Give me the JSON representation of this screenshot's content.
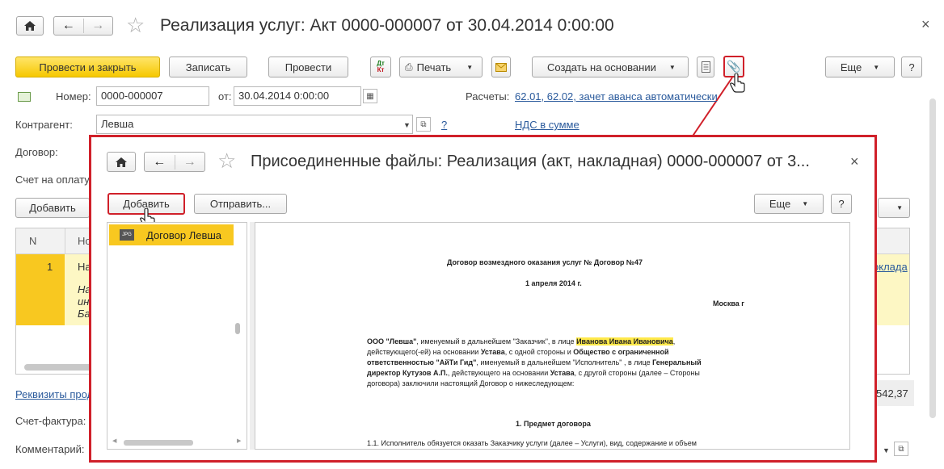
{
  "window": {
    "title": "Реализация услуг: Акт 0000-000007 от 30.04.2014 0:00:00",
    "close_glyph": "×"
  },
  "toolbar": {
    "post_close": "Провести и закрыть",
    "save": "Записать",
    "post": "Провести",
    "print": "Печать",
    "create_based": "Создать на основании",
    "more": "Еще",
    "help": "?"
  },
  "form": {
    "number_label": "Номер:",
    "number_value": "0000-000007",
    "date_label": "от:",
    "date_value": "30.04.2014  0:00:00",
    "settlements_label": "Расчеты:",
    "settlements_link": "62.01, 62.02, зачет аванса автоматически",
    "contractor_label": "Контрагент:",
    "contractor_value": "Левша",
    "contractor_help": "?",
    "vat_link": "НДС в сумме",
    "contract_label": "Договор:",
    "invoice_label": "Счет на оплату",
    "add_button": "Добавить",
    "table_col_n": "N",
    "table_col_name": "Но",
    "row1_n": "1",
    "row1_name": "На",
    "row1_sub1": "На",
    "row1_sub2": "ин",
    "row1_sub3": "Ба",
    "row1_right_link": "оклада",
    "requisites_link": "Реквизиты прод",
    "total_value": "542,37",
    "invoice_factura_label": "Счет-фактура:",
    "comment_label": "Комментарий:"
  },
  "dialog": {
    "title": "Присоединенные файлы: Реализация (акт, накладная) 0000-000007 от 3...",
    "add": "Добавить",
    "send": "Отправить...",
    "more": "Еще",
    "help": "?",
    "close_glyph": "×",
    "files": [
      {
        "name": "Договор Левша",
        "icon": "jpg-file-icon",
        "badge": "JPG"
      }
    ]
  },
  "document": {
    "title": "Договор возмездного оказания услуг № Договор №47",
    "date": "1 апреля 2014 г.",
    "city": "Москва г",
    "p1": [
      {
        "t": "ООО \"Левша\"",
        "s": "b"
      },
      {
        "t": ", именуемый в дальнейшем \"Заказчик\", в лице ",
        "s": ""
      },
      {
        "t": "Иванова Ивана Ивановича",
        "s": "hl"
      },
      {
        "t": ",",
        "s": ""
      }
    ],
    "p2": [
      {
        "t": "действующего(-ей) на основании ",
        "s": ""
      },
      {
        "t": "Устава",
        "s": "b"
      },
      {
        "t": ", с одной стороны и ",
        "s": ""
      },
      {
        "t": "Общество с ограниченной",
        "s": "b"
      }
    ],
    "p3": [
      {
        "t": "ответственностью \"АйТи Гид\"",
        "s": "b"
      },
      {
        "t": ", именуемый в дальнейшем \"Исполнитель\" , в лице ",
        "s": ""
      },
      {
        "t": "Генеральный",
        "s": "b"
      }
    ],
    "p4": [
      {
        "t": "директор Кутузов А.П.",
        "s": "b"
      },
      {
        "t": ", действующего на основании ",
        "s": ""
      },
      {
        "t": "Устава",
        "s": "b"
      },
      {
        "t": ", с другой стороны (далее – Стороны",
        "s": ""
      }
    ],
    "p5": [
      {
        "t": "договора) заключили настоящий Договор о нижеследующем:",
        "s": ""
      }
    ],
    "section1": "1. Предмет договора",
    "clause11": "1.1. Исполнитель обязуется оказать Заказчику услуги (далее – Услуги), вид, содержание и объем"
  },
  "colors": {
    "accent_yellow": "#f6c800",
    "highlight": "#ffe94a",
    "callout_red": "#d0202a",
    "link": "#2a5a9c"
  }
}
